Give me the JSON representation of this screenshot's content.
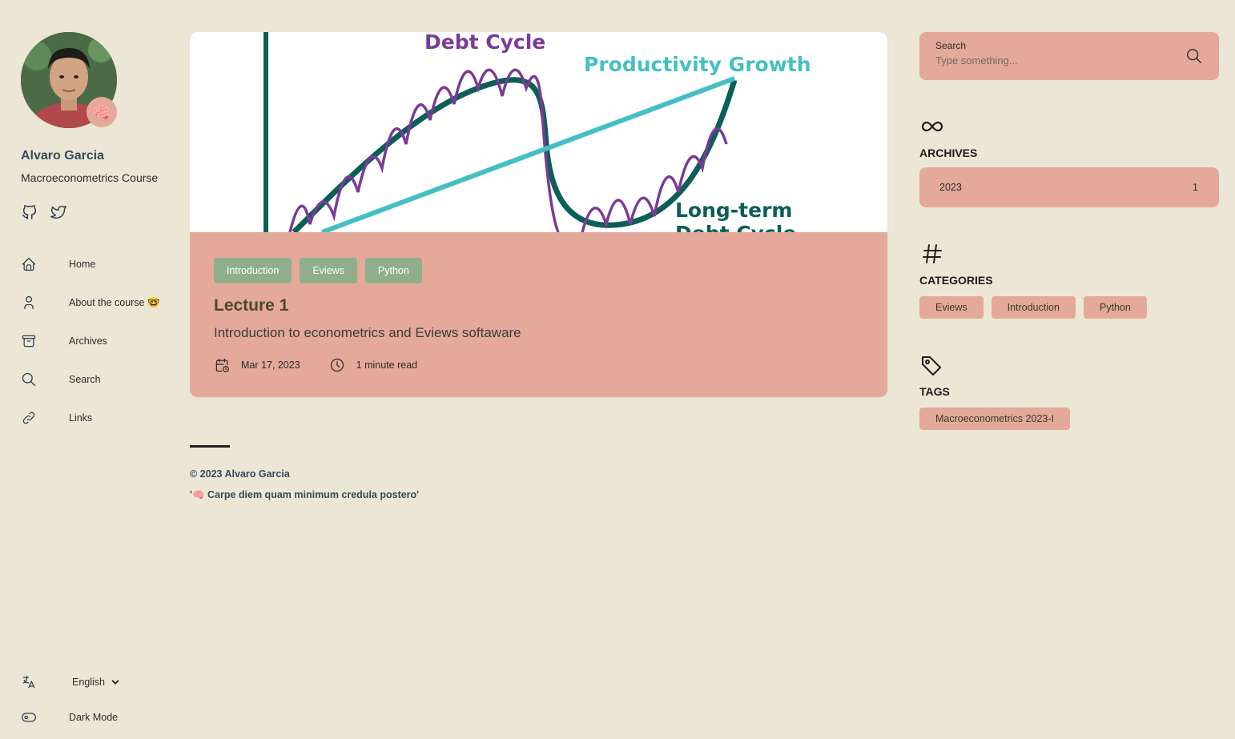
{
  "sidebar": {
    "name": "Alvaro Garcia",
    "description": "Macroeconometrics Course",
    "avatar_emoji": "🧠",
    "nav": [
      {
        "label": "Home",
        "icon": "home-icon"
      },
      {
        "label": "About the course 🤓",
        "icon": "user-icon"
      },
      {
        "label": "Archives",
        "icon": "archive-icon"
      },
      {
        "label": "Search",
        "icon": "search-icon"
      },
      {
        "label": "Links",
        "icon": "link-icon"
      }
    ],
    "language": "English",
    "dark_mode_label": "Dark Mode"
  },
  "post": {
    "image_text": {
      "debt_cycle": "Debt Cycle",
      "productivity": "Productivity Growth",
      "long_term_1": "Long-term",
      "long_term_2": "Debt Cycle"
    },
    "tags": [
      "Introduction",
      "Eviews",
      "Python"
    ],
    "title": "Lecture 1",
    "subtitle": "Introduction to econometrics and Eviews softaware",
    "date": "Mar 17, 2023",
    "read_time": "1 minute read"
  },
  "footer": {
    "copyright": "© 2023 Alvaro Garcia",
    "quote": "'🧠 Carpe diem quam minimum credula postero'"
  },
  "right": {
    "search": {
      "label": "Search",
      "placeholder": "Type something..."
    },
    "archives": {
      "title": "ARCHIVES",
      "year": "2023",
      "count": "1"
    },
    "categories": {
      "title": "CATEGORIES",
      "items": [
        "Eviews",
        "Introduction",
        "Python"
      ]
    },
    "tags": {
      "title": "TAGS",
      "items": [
        "Macroeconometrics 2023-I"
      ]
    }
  },
  "colors": {
    "background": "#ece7d5",
    "card_accent": "#e4a99a",
    "tag_green": "#8fae8a",
    "debt_purple": "#7a3b96",
    "productivity_teal": "#45bfc4",
    "longterm_green": "#0c5e59"
  }
}
